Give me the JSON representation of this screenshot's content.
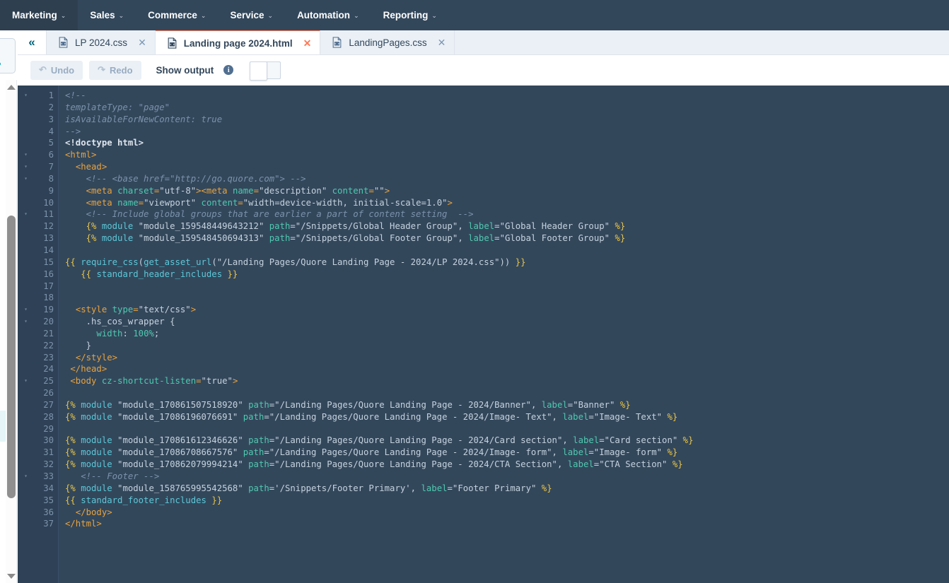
{
  "topnav": {
    "items": [
      {
        "label": "Marketing",
        "active": true
      },
      {
        "label": "Sales",
        "active": false
      },
      {
        "label": "Commerce",
        "active": false
      },
      {
        "label": "Service",
        "active": false
      },
      {
        "label": "Automation",
        "active": false
      },
      {
        "label": "Reporting",
        "active": false
      }
    ],
    "caret": "⌄",
    "background": "#33475b",
    "active_background": "#2e3f50"
  },
  "tabbar": {
    "collapse_icon": "«",
    "tabs": [
      {
        "label": "LP 2024.css",
        "active": false,
        "close": "✕",
        "icon": "file-code-icon"
      },
      {
        "label": "Landing page 2024.html",
        "active": true,
        "close": "✕",
        "icon": "file-code-icon"
      },
      {
        "label": "LandingPages.css",
        "active": false,
        "close": "✕",
        "icon": "file-code-icon"
      }
    ],
    "active_accent": "#ff7a59"
  },
  "toolbar": {
    "undo_label": "Undo",
    "undo_icon": "↶",
    "redo_label": "Redo",
    "redo_icon": "↷",
    "show_output_label": "Show output",
    "info_icon": "i",
    "toggle_state": "off"
  },
  "editor": {
    "theme_background": "#33475b",
    "gutter_background": "#2e4156",
    "total_lines": 37,
    "fold_lines": [
      1,
      6,
      7,
      8,
      11,
      19,
      20,
      25,
      33
    ],
    "lines": [
      {
        "n": 1,
        "text": "<!--"
      },
      {
        "n": 2,
        "text": "templateType: \"page\""
      },
      {
        "n": 3,
        "text": "isAvailableForNewContent: true"
      },
      {
        "n": 4,
        "text": "-->"
      },
      {
        "n": 5,
        "text": "<!doctype html>"
      },
      {
        "n": 6,
        "text": "<html>"
      },
      {
        "n": 7,
        "text": "  <head>"
      },
      {
        "n": 8,
        "text": "    <!-- <base href=\"http://go.quore.com\"> -->"
      },
      {
        "n": 9,
        "text": "    <meta charset=\"utf-8\"><meta name=\"description\" content=\"\">"
      },
      {
        "n": 10,
        "text": "    <meta name=\"viewport\" content=\"width=device-width, initial-scale=1.0\">"
      },
      {
        "n": 11,
        "text": "    <!-- Include global groups that are earlier a part of content setting  -->"
      },
      {
        "n": 12,
        "text": "    {% module \"module_159548449643212\" path=\"/Snippets/Global Header Group\", label=\"Global Header Group\" %}"
      },
      {
        "n": 13,
        "text": "    {% module \"module_159548450694313\" path=\"/Snippets/Global Footer Group\", label=\"Global Footer Group\" %}"
      },
      {
        "n": 14,
        "text": ""
      },
      {
        "n": 15,
        "text": "{{ require_css(get_asset_url(\"/Landing Pages/Quore Landing Page - 2024/LP 2024.css\")) }}"
      },
      {
        "n": 16,
        "text": "   {{ standard_header_includes }}"
      },
      {
        "n": 17,
        "text": ""
      },
      {
        "n": 18,
        "text": ""
      },
      {
        "n": 19,
        "text": "  <style type=\"text/css\">"
      },
      {
        "n": 20,
        "text": "    .hs_cos_wrapper {"
      },
      {
        "n": 21,
        "text": "      width: 100%;"
      },
      {
        "n": 22,
        "text": "    }"
      },
      {
        "n": 23,
        "text": "  </style>"
      },
      {
        "n": 24,
        "text": " </head>"
      },
      {
        "n": 25,
        "text": " <body cz-shortcut-listen=\"true\">"
      },
      {
        "n": 26,
        "text": ""
      },
      {
        "n": 27,
        "text": "{% module \"module_170861507518920\" path=\"/Landing Pages/Quore Landing Page - 2024/Banner\", label=\"Banner\" %}"
      },
      {
        "n": 28,
        "text": "{% module \"module_17086196076691\" path=\"/Landing Pages/Quore Landing Page - 2024/Image- Text\", label=\"Image- Text\" %}"
      },
      {
        "n": 29,
        "text": ""
      },
      {
        "n": 30,
        "text": "{% module \"module_170861612346626\" path=\"/Landing Pages/Quore Landing Page - 2024/Card section\", label=\"Card section\" %}"
      },
      {
        "n": 31,
        "text": "{% module \"module_17086708667576\" path=\"/Landing Pages/Quore Landing Page - 2024/Image- form\", label=\"Image- form\" %}"
      },
      {
        "n": 32,
        "text": "{% module \"module_170862079994214\" path=\"/Landing Pages/Quore Landing Page - 2024/CTA Section\", label=\"CTA Section\" %}"
      },
      {
        "n": 33,
        "text": "   <!-- Footer -->"
      },
      {
        "n": 34,
        "text": "{% module \"module_158765995542568\" path='/Snippets/Footer Primary', label=\"Footer Primary\" %}"
      },
      {
        "n": 35,
        "text": "{{ standard_footer_includes }}"
      },
      {
        "n": 36,
        "text": "  </body>"
      },
      {
        "n": 37,
        "text": "</html>"
      }
    ]
  },
  "scrollbar": {
    "up_arrow": "▲",
    "down_arrow": "▼"
  }
}
